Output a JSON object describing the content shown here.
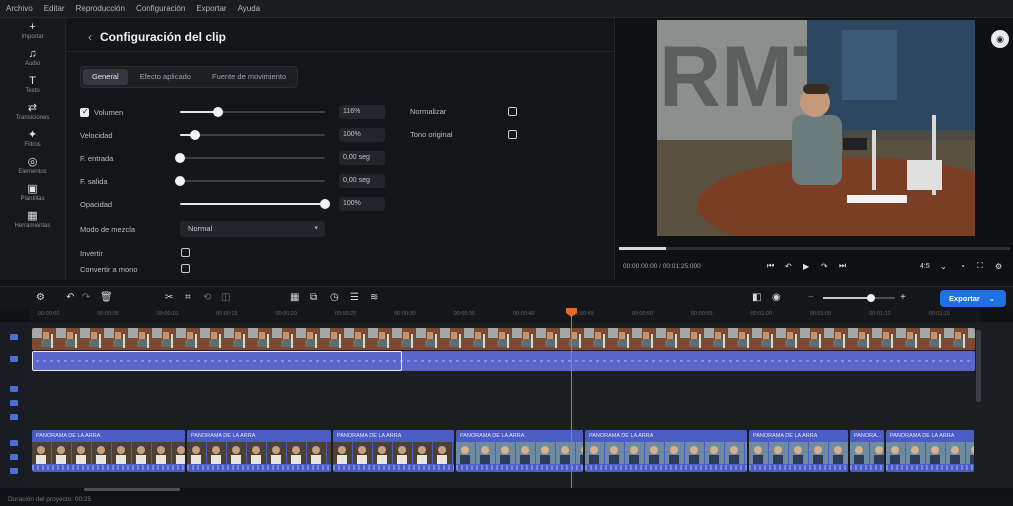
{
  "menubar": {
    "items": [
      "Archivo",
      "Editar",
      "Reproducción",
      "Configuración",
      "Exportar",
      "Ayuda"
    ]
  },
  "left_rail": {
    "items": [
      {
        "icon": "import-icon",
        "glyph": "+",
        "label": "Importar"
      },
      {
        "icon": "music-icon",
        "glyph": "♫",
        "label": "Audio"
      },
      {
        "icon": "text-icon",
        "glyph": "T",
        "label": "Texto"
      },
      {
        "icon": "transitions-icon",
        "glyph": "⇄",
        "label": "Transiciones"
      },
      {
        "icon": "filters-icon",
        "glyph": "✦",
        "label": "Filtros"
      },
      {
        "icon": "effects-icon",
        "glyph": "◎",
        "label": "Elementos"
      },
      {
        "icon": "templates-icon",
        "glyph": "▣",
        "label": "Plantillas"
      },
      {
        "icon": "tools-icon",
        "glyph": "▦",
        "label": "Herramientas"
      }
    ]
  },
  "settings": {
    "title": "Configuración del clip",
    "tabs": [
      "General",
      "Efecto aplicado",
      "Fuente de movimiento"
    ],
    "rows": {
      "volume": {
        "label": "Volumen",
        "value": "116%",
        "level": 0.26,
        "checked": true
      },
      "speed": {
        "label": "Velocidad",
        "value": "100%",
        "level": 0.1
      },
      "fadein": {
        "label": "F. entrada",
        "value": "0,00 seg",
        "level": 0.0
      },
      "fadeout": {
        "label": "F. salida",
        "value": "0,00 seg",
        "level": 0.0
      },
      "opacity": {
        "label": "Opacidad",
        "value": "100%",
        "level": 1.0
      }
    },
    "normalize_label": "Normalizar",
    "original_tone_label": "Tono original",
    "blend_label": "Modo de mezcla",
    "blend_value": "Normal",
    "invert_label": "Invertir",
    "convert_mono_label": "Convertir a mono"
  },
  "preview": {
    "timecode": "00:00:00:00 / 00:01:25:000",
    "progress": 0.12,
    "zoom_label": "4:5"
  },
  "timeline": {
    "export_label": "Exportar",
    "zoom_level": 0.66,
    "ruler_labels": [
      "00:00:00",
      "00:00:05",
      "00:00:10",
      "00:00:15",
      "00:00:20",
      "00:00:25",
      "00:00:30",
      "00:00:35",
      "00:00:40",
      "00:00:45",
      "00:00:50",
      "00:00:55",
      "00:01:00",
      "00:01:05",
      "00:01:10",
      "00:01:15"
    ],
    "clips": [
      {
        "label": "PANORAMA DE LA ARRA"
      },
      {
        "label": "PANORAMA DE LA ARRA"
      },
      {
        "label": "PANORAMA DE LA ARRA"
      },
      {
        "label": "PANORAMA DE LA ARRA"
      },
      {
        "label": "PANORAMA DE LA ARRA"
      },
      {
        "label": "PANORAMA DE LA ARRA"
      },
      {
        "label": "PANORA..."
      },
      {
        "label": "PANORAMA DE LA ARRA"
      }
    ]
  },
  "status": {
    "text": "Duración del proyecto: 00:25"
  },
  "colors": {
    "accent": "#1f6fe5",
    "playhead": "#e8682a",
    "clip": "#4b5cc4"
  }
}
